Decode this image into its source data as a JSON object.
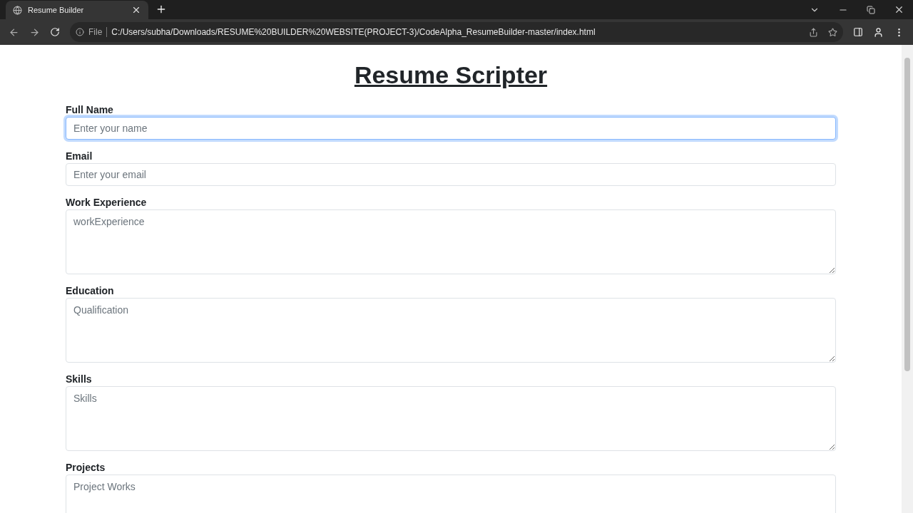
{
  "browser": {
    "tab": {
      "title": "Resume Builder",
      "selected": true
    },
    "address": {
      "scheme": "File",
      "url": "C:/Users/subha/Downloads/RESUME%20BUILDER%20WEBSITE(PROJECT-3)/CodeAlpha_ResumeBuilder-master/index.html"
    }
  },
  "page": {
    "title": "Resume Scripter",
    "fields": [
      {
        "label": "Full Name",
        "kind": "input",
        "placeholder": "Enter your name",
        "focused": true
      },
      {
        "label": "Email",
        "kind": "input",
        "placeholder": "Enter your email",
        "focused": false
      },
      {
        "label": "Work Experience",
        "kind": "textarea",
        "placeholder": "workExperience",
        "focused": false
      },
      {
        "label": "Education",
        "kind": "textarea",
        "placeholder": "Qualification",
        "focused": false
      },
      {
        "label": "Skills",
        "kind": "textarea",
        "placeholder": "Skills",
        "focused": false
      },
      {
        "label": "Projects",
        "kind": "textarea",
        "placeholder": "Project Works",
        "focused": false
      }
    ]
  }
}
